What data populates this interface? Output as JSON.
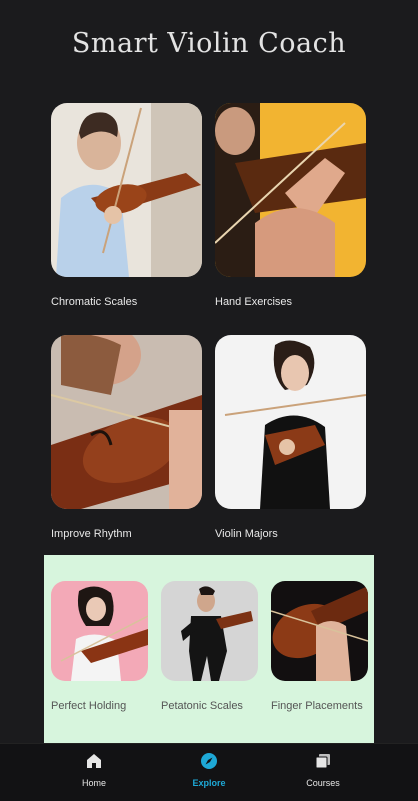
{
  "app": {
    "title": "Smart Violin Coach"
  },
  "cards": [
    {
      "label": "Chromatic Scales"
    },
    {
      "label": "Hand Exercises"
    },
    {
      "label": "Improve Rhythm"
    },
    {
      "label": "Violin Majors"
    }
  ],
  "panel": {
    "items": [
      {
        "label": "Perfect Holding"
      },
      {
        "label": "Petatonic Scales"
      },
      {
        "label": "Finger Placements"
      }
    ]
  },
  "nav": {
    "items": [
      {
        "label": "Home",
        "icon": "home-icon"
      },
      {
        "label": "Explore",
        "icon": "compass-icon"
      },
      {
        "label": "Courses",
        "icon": "layers-icon"
      }
    ],
    "active": "Explore",
    "active_color": "#1ea8d6"
  }
}
